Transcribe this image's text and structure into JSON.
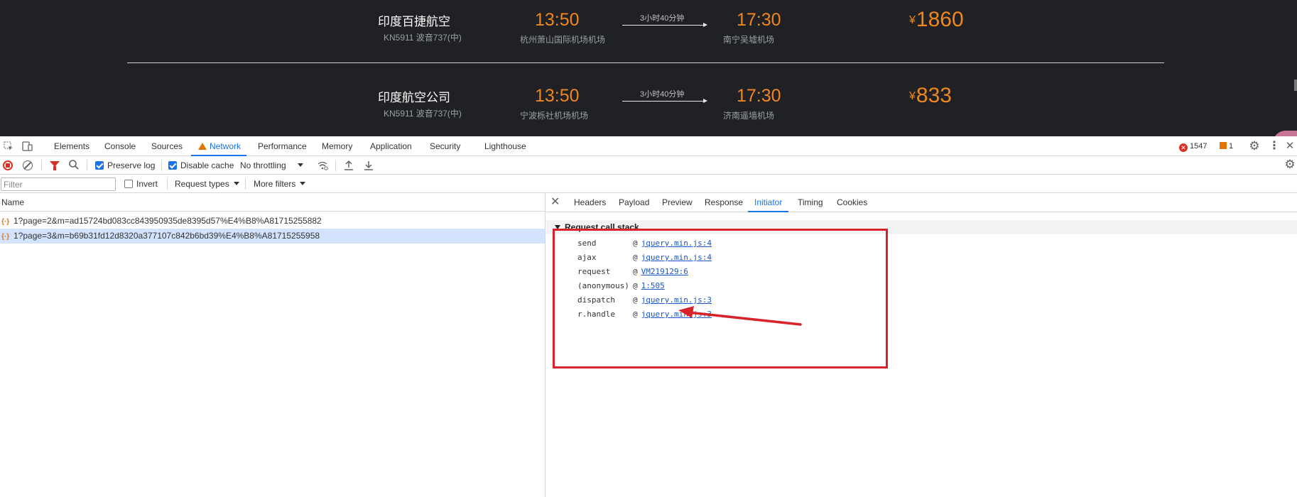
{
  "page": {
    "flights": [
      {
        "airline": "印度百捷航空",
        "flight_no": "KN5911 波音737(中)",
        "dep_time": "13:50",
        "dep_airport": "杭州萧山国际机场机场",
        "duration": "3小时40分钟",
        "arr_time": "17:30",
        "arr_airport": "南宁吴墟机场",
        "currency": "¥",
        "price": "1860"
      },
      {
        "airline": "印度航空公司",
        "flight_no": "KN5911 波音737(中)",
        "dep_time": "13:50",
        "dep_airport": "宁波栎社机场机场",
        "duration": "3小时40分钟",
        "arr_time": "17:30",
        "arr_airport": "济南遥墙机场",
        "currency": "¥",
        "price": "833"
      }
    ]
  },
  "devtools": {
    "tabs": [
      "Elements",
      "Console",
      "Sources",
      "Network",
      "Performance",
      "Memory",
      "Application",
      "Security",
      "Lighthouse"
    ],
    "active_tab": "Network",
    "error_count": "1547",
    "warning_count": "1",
    "toolbar": {
      "preserve_log": "Preserve log",
      "preserve_log_checked": true,
      "disable_cache": "Disable cache",
      "disable_cache_checked": true,
      "throttling": "No throttling"
    },
    "filterbar": {
      "filter_placeholder": "Filter",
      "invert": "Invert",
      "request_types": "Request types",
      "more_filters": "More filters"
    },
    "requests": {
      "column_name": "Name",
      "rows": [
        {
          "name": "1?page=2&m=ad15724bd083cc843950935de8395d57%E4%B8%A81715255882",
          "selected": false
        },
        {
          "name": "1?page=3&m=b69b31fd12d8320a377107c842b6bd39%E4%B8%A81715255958",
          "selected": true
        }
      ]
    },
    "details": {
      "tabs": [
        "Headers",
        "Payload",
        "Preview",
        "Response",
        "Initiator",
        "Timing",
        "Cookies"
      ],
      "active_tab": "Initiator",
      "section_title": "Request call stack",
      "call_stack": [
        {
          "fn": "send",
          "at": "@",
          "src": "jquery.min.js:4"
        },
        {
          "fn": "ajax",
          "at": "@",
          "src": "jquery.min.js:4"
        },
        {
          "fn": "request",
          "at": "@",
          "src": "VM219129:6"
        },
        {
          "fn": "(anonymous)",
          "at": "@",
          "src": "1:505"
        },
        {
          "fn": "dispatch",
          "at": "@",
          "src": "jquery.min.js:3"
        },
        {
          "fn": "r.handle",
          "at": "@",
          "src": "jquery.min.js:3"
        }
      ]
    },
    "colors": {
      "accent": "#1a73e8",
      "highlight": "#d8232a",
      "price": "#f0861d"
    }
  }
}
